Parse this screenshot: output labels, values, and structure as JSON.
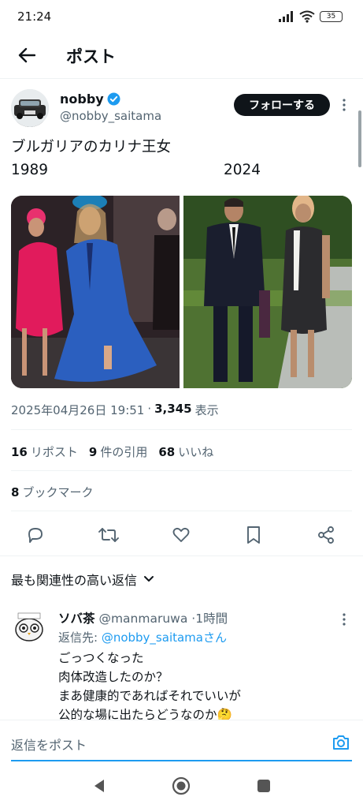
{
  "status_bar": {
    "time": "21:24",
    "battery": "35"
  },
  "header": {
    "title": "ポスト"
  },
  "post": {
    "display_name": "nobby",
    "handle": "@nobby_saitama",
    "follow_label": "フォローする",
    "text": "ブルガリアのカリナ王女",
    "year_left": "1989",
    "year_right": "2024",
    "timestamp": "2025年04月26日 19:51",
    "views_count": "3,345",
    "views_label": "表示",
    "reposts_count": "16",
    "reposts_label": "リポスト",
    "quotes_count": "9",
    "quotes_label": "件の引用",
    "likes_count": "68",
    "likes_label": "いいね",
    "bookmarks_count": "8",
    "bookmarks_label": "ブックマーク"
  },
  "sort": {
    "label": "最も関連性の高い返信"
  },
  "reply": {
    "display_name": "ソバ茶",
    "handle": "@manmaruwa",
    "time": "1時間",
    "reply_to_prefix": "返信先: ",
    "reply_to_mention": "@nobby_saitamaさん",
    "lines": [
      "ごっつくなった",
      "肉体改造したのか？",
      "まあ健康的であればそれでいいが",
      "公的な場に出たらどうなのか🤔"
    ]
  },
  "compose": {
    "placeholder": "返信をポスト"
  },
  "colors": {
    "accent": "#1d9bf0",
    "text": "#0f1419",
    "secondary": "#536471"
  },
  "icons": [
    "back-arrow-icon",
    "verified-badge-icon",
    "more-icon",
    "reply-icon",
    "repost-icon",
    "like-icon",
    "bookmark-icon",
    "share-icon",
    "chevron-down-icon",
    "camera-icon",
    "nav-back-icon",
    "nav-home-icon",
    "nav-recents-icon"
  ]
}
